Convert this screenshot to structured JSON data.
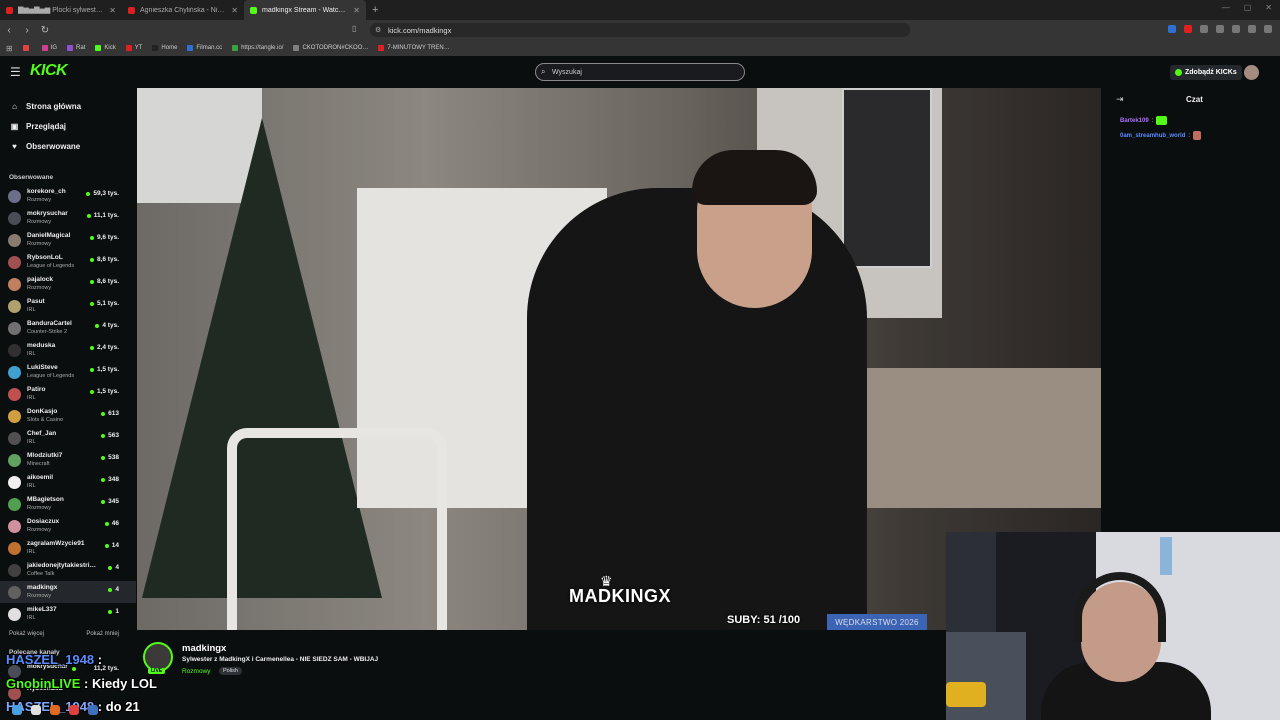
{
  "browser": {
    "tabs": [
      {
        "title": "▇▆▅▇▅▆ Plocki sylwester 202…",
        "color": "#e02020"
      },
      {
        "title": "Agnieszka Chylińska - Nie mogę Ci…",
        "color": "#e02020"
      },
      {
        "title": "madkingx Stream - Watch Li…",
        "color": "#53fc18",
        "active": true
      },
      {
        "new_tab": "+"
      }
    ],
    "url": "kick.com/madkingx",
    "bookmarks": [
      {
        "label": "",
        "color": "#e04040"
      },
      {
        "label": "IG",
        "color": "#d04090"
      },
      {
        "label": "Rat",
        "color": "#9050d0"
      },
      {
        "label": "Kick",
        "color": "#53fc18"
      },
      {
        "label": "YT",
        "color": "#e02020"
      },
      {
        "label": "Home",
        "color": "#222222"
      },
      {
        "label": "Filman.cc",
        "color": "#3070d0"
      },
      {
        "label": "https://tangle.io/",
        "color": "#40a040"
      },
      {
        "label": "CKOTODRON#CKOO…",
        "color": "#808080"
      },
      {
        "label": "7-MINUTOWY TREN…",
        "color": "#e02020"
      }
    ]
  },
  "header": {
    "logo": "KICK",
    "search_placeholder": "Wyszukaj",
    "kicks_button": "Zdobądź KICKs"
  },
  "sidebar": {
    "nav": [
      {
        "label": "Strona główna",
        "icon": "home-icon",
        "glyph": "⌂"
      },
      {
        "label": "Przeglądaj",
        "icon": "browse-icon",
        "glyph": "▣"
      },
      {
        "label": "Obserwowane",
        "icon": "heart-icon",
        "glyph": "♥"
      }
    ],
    "followed_title": "Obserwowane",
    "channels": [
      {
        "name": "korekore_ch",
        "category": "Rozmowy",
        "viewers": "59,3 tys.",
        "color": "#6b6f8a"
      },
      {
        "name": "mokrysuchar",
        "category": "Rozmowy",
        "viewers": "11,1 tys.",
        "color": "#4a4d55"
      },
      {
        "name": "DanielMagical",
        "category": "Rozmowy",
        "viewers": "9,6 tys.",
        "color": "#8a7a70"
      },
      {
        "name": "RybsonLoL",
        "category": "League of Legends",
        "viewers": "8,6 tys.",
        "color": "#a05050"
      },
      {
        "name": "pajalock",
        "category": "Rozmowy",
        "viewers": "8,6 tys.",
        "color": "#c08060"
      },
      {
        "name": "Pasut",
        "category": "IRL",
        "viewers": "5,1 tys.",
        "color": "#b0a070"
      },
      {
        "name": "BanduraCartel",
        "category": "Counter-Strike 2",
        "viewers": "4 tys.",
        "color": "#707070"
      },
      {
        "name": "meduska",
        "category": "IRL",
        "viewers": "2,4 tys.",
        "color": "#303030"
      },
      {
        "name": "LukiSteve",
        "category": "League of Legends",
        "viewers": "1,5 tys.",
        "color": "#40a0d0"
      },
      {
        "name": "Patiro",
        "category": "IRL",
        "viewers": "1,5 tys.",
        "color": "#c05050"
      },
      {
        "name": "DonKasjo",
        "category": "Slots & Casino",
        "viewers": "613",
        "color": "#d0a040"
      },
      {
        "name": "Chef_Jan",
        "category": "IRL",
        "viewers": "563",
        "color": "#505050"
      },
      {
        "name": "Mlodziutki7",
        "category": "Minecraft",
        "viewers": "538",
        "color": "#60a060"
      },
      {
        "name": "aikoemil",
        "category": "IRL",
        "viewers": "348",
        "color": "#f0f0f0"
      },
      {
        "name": "MBagietson",
        "category": "Rozmowy",
        "viewers": "345",
        "color": "#50a050"
      },
      {
        "name": "Dosiaczux",
        "category": "Rozmowy",
        "viewers": "46",
        "color": "#d090a0"
      },
      {
        "name": "zagralamWzycie91",
        "category": "IRL",
        "viewers": "14",
        "color": "#c07030"
      },
      {
        "name": "jakiedonejtytakiestri…",
        "category": "Coffee Talk",
        "viewers": "4",
        "color": "#404040"
      },
      {
        "name": "madkingx",
        "category": "Rozmowy",
        "viewers": "4",
        "color": "#606060",
        "active": true
      },
      {
        "name": "mikeL337",
        "category": "IRL",
        "viewers": "1",
        "color": "#e0e0e0"
      }
    ],
    "show_more": "Pokaż więcej",
    "show_less": "Pokaż mniej",
    "recommended_title": "Polecane kanały",
    "recommended": [
      {
        "name": "mokrysuchar",
        "viewers": "11,2 tys."
      },
      {
        "name": "RybsonLoL",
        "viewers": ""
      }
    ]
  },
  "player": {
    "overlay_name": "MADKINGX",
    "subs_text": "SUBY: 51 /100",
    "event_text": "WĘDKARSTWO 2026"
  },
  "stream_info": {
    "streamer": "madkingx",
    "live_badge": "LIVE",
    "title": "Sylwester z MadkingX i Carmenellea - NIE SIEDZ SAM - WBIJAJ",
    "category": "Rozmowy",
    "tag": "Polish"
  },
  "chat": {
    "title": "Czat",
    "messages": [
      {
        "user": "Bartek109",
        "sep": ":",
        "user_color": "#b070ff",
        "emote_color": "#53fc18"
      },
      {
        "user": "0am_streamhub_world",
        "sep": ":",
        "user_color": "#5a8cff",
        "emote_color": "#c07060"
      }
    ]
  },
  "tiktok_overlay": [
    {
      "user": "HASZEL_1948",
      "text": ":"
    },
    {
      "user": "GnobinLIVE",
      "text": ": Kiedy LOL"
    },
    {
      "user": "HASZEL_1948",
      "text": ": do 21"
    }
  ]
}
